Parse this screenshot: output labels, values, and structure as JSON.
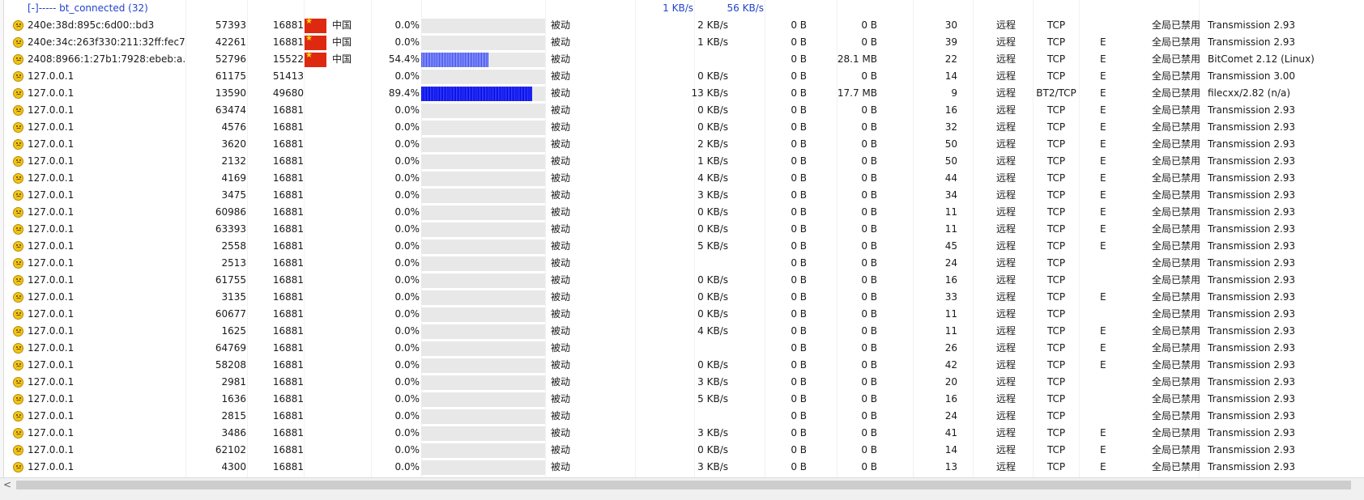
{
  "group_header": {
    "label": "[-]----- bt_connected (32)",
    "down_speed": "1 KB/s",
    "up_speed": "56 KB/s"
  },
  "colors": {
    "progress_bg": "#e8e8e8",
    "progress_fill": "#4a5cf4",
    "progress_fill_heavy": "#0a14f0",
    "group_text": "#2244cc",
    "flag_red": "#de2910",
    "flag_star": "#ffde00"
  },
  "rows": [
    {
      "ip": "240e:38d:895c:6d00::bd3",
      "port": "57393",
      "lport": "16881",
      "country": "中国",
      "progress": "0.0%",
      "fill": 0,
      "mode": "被动",
      "speed": "2 KB/s",
      "dl": "0 B",
      "ul": "0 B",
      "num": "30",
      "conn": "远程",
      "proto": "TCP",
      "flag": "",
      "status": "全局已禁用",
      "client": "Transmission 2.93"
    },
    {
      "ip": "240e:34c:263f330:211:32ff:fec7...",
      "port": "42261",
      "lport": "16881",
      "country": "中国",
      "progress": "0.0%",
      "fill": 0,
      "mode": "被动",
      "speed": "1 KB/s",
      "dl": "0 B",
      "ul": "0 B",
      "num": "39",
      "conn": "远程",
      "proto": "TCP",
      "flag": "E",
      "status": "全局已禁用",
      "client": "Transmission 2.93"
    },
    {
      "ip": "2408:8966:1:27b1:7928:ebeb:a...",
      "port": "52796",
      "lport": "15522",
      "country": "中国",
      "progress": "54.4%",
      "fill": 0.544,
      "mode": "被动",
      "speed": "",
      "dl": "0 B",
      "ul": "28.1 MB",
      "num": "22",
      "conn": "远程",
      "proto": "TCP",
      "flag": "E",
      "status": "全局已禁用",
      "client": "BitComet 2.12 (Linux)"
    },
    {
      "ip": "127.0.0.1",
      "port": "61175",
      "lport": "51413",
      "country": "",
      "progress": "0.0%",
      "fill": 0,
      "mode": "被动",
      "speed": "0 KB/s",
      "dl": "0 B",
      "ul": "0 B",
      "num": "14",
      "conn": "远程",
      "proto": "TCP",
      "flag": "E",
      "status": "全局已禁用",
      "client": "Transmission 3.00"
    },
    {
      "ip": "127.0.0.1",
      "port": "13590",
      "lport": "49680",
      "country": "",
      "progress": "89.4%",
      "fill": 0.894,
      "mode": "被动",
      "speed": "13 KB/s",
      "dl": "0 B",
      "ul": "17.7 MB",
      "num": "9",
      "conn": "远程",
      "proto": "BT2/TCP",
      "flag": "E",
      "status": "全局已禁用",
      "client": "filecxx/2.82 (n/a)"
    },
    {
      "ip": "127.0.0.1",
      "port": "63474",
      "lport": "16881",
      "country": "",
      "progress": "0.0%",
      "fill": 0,
      "mode": "被动",
      "speed": "0 KB/s",
      "dl": "0 B",
      "ul": "0 B",
      "num": "16",
      "conn": "远程",
      "proto": "TCP",
      "flag": "E",
      "status": "全局已禁用",
      "client": "Transmission 2.93"
    },
    {
      "ip": "127.0.0.1",
      "port": "4576",
      "lport": "16881",
      "country": "",
      "progress": "0.0%",
      "fill": 0,
      "mode": "被动",
      "speed": "0 KB/s",
      "dl": "0 B",
      "ul": "0 B",
      "num": "32",
      "conn": "远程",
      "proto": "TCP",
      "flag": "E",
      "status": "全局已禁用",
      "client": "Transmission 2.93"
    },
    {
      "ip": "127.0.0.1",
      "port": "3620",
      "lport": "16881",
      "country": "",
      "progress": "0.0%",
      "fill": 0,
      "mode": "被动",
      "speed": "2 KB/s",
      "dl": "0 B",
      "ul": "0 B",
      "num": "50",
      "conn": "远程",
      "proto": "TCP",
      "flag": "E",
      "status": "全局已禁用",
      "client": "Transmission 2.93"
    },
    {
      "ip": "127.0.0.1",
      "port": "2132",
      "lport": "16881",
      "country": "",
      "progress": "0.0%",
      "fill": 0,
      "mode": "被动",
      "speed": "1 KB/s",
      "dl": "0 B",
      "ul": "0 B",
      "num": "50",
      "conn": "远程",
      "proto": "TCP",
      "flag": "E",
      "status": "全局已禁用",
      "client": "Transmission 2.93"
    },
    {
      "ip": "127.0.0.1",
      "port": "4169",
      "lport": "16881",
      "country": "",
      "progress": "0.0%",
      "fill": 0,
      "mode": "被动",
      "speed": "4 KB/s",
      "dl": "0 B",
      "ul": "0 B",
      "num": "44",
      "conn": "远程",
      "proto": "TCP",
      "flag": "E",
      "status": "全局已禁用",
      "client": "Transmission 2.93"
    },
    {
      "ip": "127.0.0.1",
      "port": "3475",
      "lport": "16881",
      "country": "",
      "progress": "0.0%",
      "fill": 0,
      "mode": "被动",
      "speed": "3 KB/s",
      "dl": "0 B",
      "ul": "0 B",
      "num": "34",
      "conn": "远程",
      "proto": "TCP",
      "flag": "E",
      "status": "全局已禁用",
      "client": "Transmission 2.93"
    },
    {
      "ip": "127.0.0.1",
      "port": "60986",
      "lport": "16881",
      "country": "",
      "progress": "0.0%",
      "fill": 0,
      "mode": "被动",
      "speed": "0 KB/s",
      "dl": "0 B",
      "ul": "0 B",
      "num": "11",
      "conn": "远程",
      "proto": "TCP",
      "flag": "E",
      "status": "全局已禁用",
      "client": "Transmission 2.93"
    },
    {
      "ip": "127.0.0.1",
      "port": "63393",
      "lport": "16881",
      "country": "",
      "progress": "0.0%",
      "fill": 0,
      "mode": "被动",
      "speed": "0 KB/s",
      "dl": "0 B",
      "ul": "0 B",
      "num": "11",
      "conn": "远程",
      "proto": "TCP",
      "flag": "E",
      "status": "全局已禁用",
      "client": "Transmission 2.93"
    },
    {
      "ip": "127.0.0.1",
      "port": "2558",
      "lport": "16881",
      "country": "",
      "progress": "0.0%",
      "fill": 0,
      "mode": "被动",
      "speed": "5 KB/s",
      "dl": "0 B",
      "ul": "0 B",
      "num": "45",
      "conn": "远程",
      "proto": "TCP",
      "flag": "E",
      "status": "全局已禁用",
      "client": "Transmission 2.93"
    },
    {
      "ip": "127.0.0.1",
      "port": "2513",
      "lport": "16881",
      "country": "",
      "progress": "0.0%",
      "fill": 0,
      "mode": "被动",
      "speed": "",
      "dl": "0 B",
      "ul": "0 B",
      "num": "24",
      "conn": "远程",
      "proto": "TCP",
      "flag": "",
      "status": "全局已禁用",
      "client": "Transmission 2.93"
    },
    {
      "ip": "127.0.0.1",
      "port": "61755",
      "lport": "16881",
      "country": "",
      "progress": "0.0%",
      "fill": 0,
      "mode": "被动",
      "speed": "0 KB/s",
      "dl": "0 B",
      "ul": "0 B",
      "num": "16",
      "conn": "远程",
      "proto": "TCP",
      "flag": "",
      "status": "全局已禁用",
      "client": "Transmission 2.93"
    },
    {
      "ip": "127.0.0.1",
      "port": "3135",
      "lport": "16881",
      "country": "",
      "progress": "0.0%",
      "fill": 0,
      "mode": "被动",
      "speed": "0 KB/s",
      "dl": "0 B",
      "ul": "0 B",
      "num": "33",
      "conn": "远程",
      "proto": "TCP",
      "flag": "E",
      "status": "全局已禁用",
      "client": "Transmission 2.93"
    },
    {
      "ip": "127.0.0.1",
      "port": "60677",
      "lport": "16881",
      "country": "",
      "progress": "0.0%",
      "fill": 0,
      "mode": "被动",
      "speed": "0 KB/s",
      "dl": "0 B",
      "ul": "0 B",
      "num": "11",
      "conn": "远程",
      "proto": "TCP",
      "flag": "",
      "status": "全局已禁用",
      "client": "Transmission 2.93"
    },
    {
      "ip": "127.0.0.1",
      "port": "1625",
      "lport": "16881",
      "country": "",
      "progress": "0.0%",
      "fill": 0,
      "mode": "被动",
      "speed": "4 KB/s",
      "dl": "0 B",
      "ul": "0 B",
      "num": "11",
      "conn": "远程",
      "proto": "TCP",
      "flag": "E",
      "status": "全局已禁用",
      "client": "Transmission 2.93"
    },
    {
      "ip": "127.0.0.1",
      "port": "64769",
      "lport": "16881",
      "country": "",
      "progress": "0.0%",
      "fill": 0,
      "mode": "被动",
      "speed": "",
      "dl": "0 B",
      "ul": "0 B",
      "num": "26",
      "conn": "远程",
      "proto": "TCP",
      "flag": "E",
      "status": "全局已禁用",
      "client": "Transmission 2.93"
    },
    {
      "ip": "127.0.0.1",
      "port": "58208",
      "lport": "16881",
      "country": "",
      "progress": "0.0%",
      "fill": 0,
      "mode": "被动",
      "speed": "0 KB/s",
      "dl": "0 B",
      "ul": "0 B",
      "num": "42",
      "conn": "远程",
      "proto": "TCP",
      "flag": "E",
      "status": "全局已禁用",
      "client": "Transmission 2.93"
    },
    {
      "ip": "127.0.0.1",
      "port": "2981",
      "lport": "16881",
      "country": "",
      "progress": "0.0%",
      "fill": 0,
      "mode": "被动",
      "speed": "3 KB/s",
      "dl": "0 B",
      "ul": "0 B",
      "num": "20",
      "conn": "远程",
      "proto": "TCP",
      "flag": "",
      "status": "全局已禁用",
      "client": "Transmission 2.93"
    },
    {
      "ip": "127.0.0.1",
      "port": "1636",
      "lport": "16881",
      "country": "",
      "progress": "0.0%",
      "fill": 0,
      "mode": "被动",
      "speed": "5 KB/s",
      "dl": "0 B",
      "ul": "0 B",
      "num": "16",
      "conn": "远程",
      "proto": "TCP",
      "flag": "",
      "status": "全局已禁用",
      "client": "Transmission 2.93"
    },
    {
      "ip": "127.0.0.1",
      "port": "2815",
      "lport": "16881",
      "country": "",
      "progress": "0.0%",
      "fill": 0,
      "mode": "被动",
      "speed": "",
      "dl": "0 B",
      "ul": "0 B",
      "num": "24",
      "conn": "远程",
      "proto": "TCP",
      "flag": "",
      "status": "全局已禁用",
      "client": "Transmission 2.93"
    },
    {
      "ip": "127.0.0.1",
      "port": "3486",
      "lport": "16881",
      "country": "",
      "progress": "0.0%",
      "fill": 0,
      "mode": "被动",
      "speed": "3 KB/s",
      "dl": "0 B",
      "ul": "0 B",
      "num": "41",
      "conn": "远程",
      "proto": "TCP",
      "flag": "E",
      "status": "全局已禁用",
      "client": "Transmission 2.93"
    },
    {
      "ip": "127.0.0.1",
      "port": "62102",
      "lport": "16881",
      "country": "",
      "progress": "0.0%",
      "fill": 0,
      "mode": "被动",
      "speed": "0 KB/s",
      "dl": "0 B",
      "ul": "0 B",
      "num": "14",
      "conn": "远程",
      "proto": "TCP",
      "flag": "E",
      "status": "全局已禁用",
      "client": "Transmission 2.93"
    },
    {
      "ip": "127.0.0.1",
      "port": "4300",
      "lport": "16881",
      "country": "",
      "progress": "0.0%",
      "fill": 0,
      "mode": "被动",
      "speed": "3 KB/s",
      "dl": "0 B",
      "ul": "0 B",
      "num": "13",
      "conn": "远程",
      "proto": "TCP",
      "flag": "E",
      "status": "全局已禁用",
      "client": "Transmission 2.93"
    }
  ],
  "scrollbar": {
    "left_arrow": "<"
  }
}
